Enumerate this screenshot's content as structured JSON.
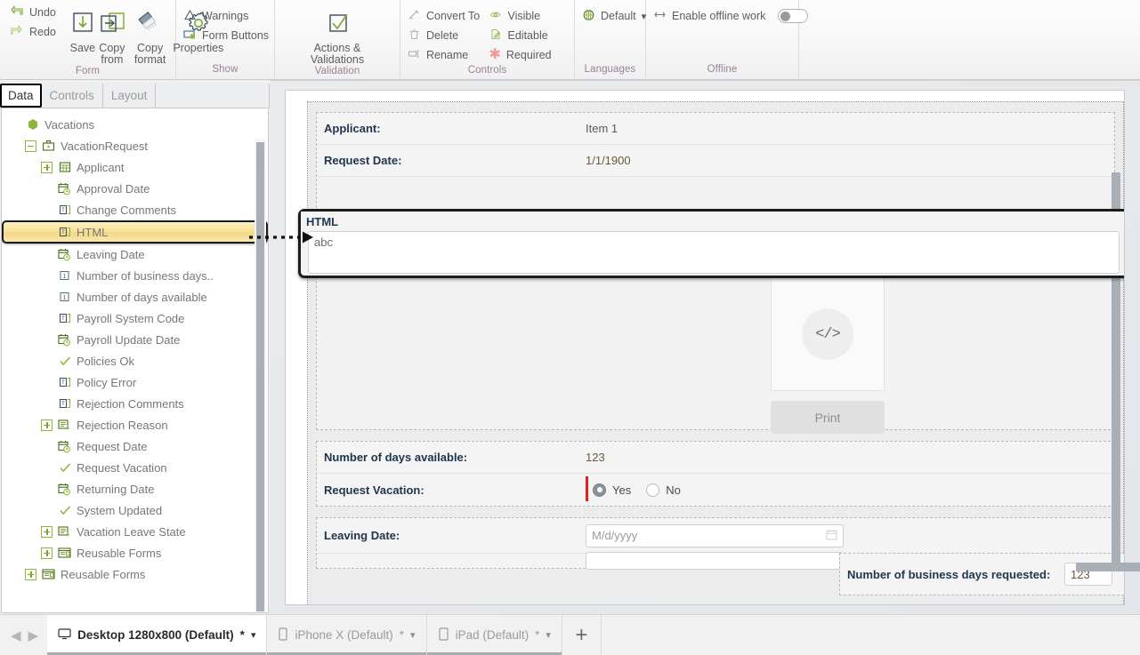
{
  "ribbon": {
    "groups": [
      {
        "title": "Form",
        "undo": "Undo",
        "redo": "Redo",
        "buttons": [
          {
            "label": "Save",
            "icon": "save-icon"
          },
          {
            "label": "Copy from",
            "icon": "copy-from-icon"
          },
          {
            "label": "Copy format",
            "icon": "copy-format-icon"
          },
          {
            "label": "Properties",
            "icon": "properties-gear-icon"
          }
        ]
      },
      {
        "title": "Show",
        "items": [
          {
            "label": "Warnings",
            "icon": "warning-triangle-icon"
          },
          {
            "label": "Form Buttons",
            "icon": "form-buttons-icon"
          }
        ]
      },
      {
        "title": "Validation",
        "buttons": [
          {
            "label": "Actions & Validations",
            "icon": "checkbox-check-icon"
          }
        ]
      },
      {
        "title": "Controls",
        "items": [
          {
            "label": "Convert To",
            "icon": "convert-to-icon"
          },
          {
            "label": "Delete",
            "icon": "trash-icon"
          },
          {
            "label": "Rename",
            "icon": "rename-icon"
          },
          {
            "label": "Visible",
            "icon": "eye-icon"
          },
          {
            "label": "Editable",
            "icon": "editable-page-icon"
          },
          {
            "label": "Required",
            "icon": "asterisk-icon"
          }
        ]
      },
      {
        "title": "Languages",
        "items": [
          {
            "label": "Default",
            "icon": "globe-icon",
            "dropdown": "▾"
          }
        ]
      },
      {
        "title": "Offline",
        "items": [
          {
            "label": "Enable offline work",
            "icon": "offline-sync-icon",
            "toggle": "off"
          }
        ]
      }
    ]
  },
  "sidebar": {
    "tabs": [
      {
        "label": "Data",
        "selected": true
      },
      {
        "label": "Controls",
        "selected": false
      },
      {
        "label": "Layout",
        "selected": false
      }
    ],
    "tree": [
      {
        "label": "Vacations",
        "indent": 0,
        "expander": "none",
        "icon": "package-icon",
        "selected": false
      },
      {
        "label": "VacationRequest",
        "indent": 1,
        "expander": "minus",
        "icon": "business-case-icon",
        "selected": false
      },
      {
        "label": "Applicant",
        "indent": 2,
        "expander": "plus",
        "icon": "table-icon",
        "selected": false
      },
      {
        "label": "Approval Date",
        "indent": 2,
        "expander": "none",
        "icon": "datetime-icon",
        "selected": false
      },
      {
        "label": "Change Comments",
        "indent": 2,
        "expander": "none",
        "icon": "text-field-icon",
        "selected": false
      },
      {
        "label": "HTML",
        "indent": 2,
        "expander": "none",
        "icon": "text-field-icon",
        "selected": true
      },
      {
        "label": "Leaving Date",
        "indent": 2,
        "expander": "none",
        "icon": "datetime-icon",
        "selected": false
      },
      {
        "label": "Number of business days..",
        "indent": 2,
        "expander": "none",
        "icon": "numeric-icon",
        "selected": false
      },
      {
        "label": "Number of days available",
        "indent": 2,
        "expander": "none",
        "icon": "numeric-icon",
        "selected": false
      },
      {
        "label": "Payroll System Code",
        "indent": 2,
        "expander": "none",
        "icon": "text-field-icon",
        "selected": false
      },
      {
        "label": "Payroll Update Date",
        "indent": 2,
        "expander": "none",
        "icon": "datetime-icon",
        "selected": false
      },
      {
        "label": "Policies Ok",
        "indent": 2,
        "expander": "none",
        "icon": "boolean-check-icon",
        "selected": false
      },
      {
        "label": "Policy Error",
        "indent": 2,
        "expander": "none",
        "icon": "text-field-icon",
        "selected": false
      },
      {
        "label": "Rejection Comments",
        "indent": 2,
        "expander": "none",
        "icon": "text-field-icon",
        "selected": false
      },
      {
        "label": "Rejection Reason",
        "indent": 2,
        "expander": "plus",
        "icon": "enum-icon",
        "selected": false
      },
      {
        "label": "Request Date",
        "indent": 2,
        "expander": "none",
        "icon": "datetime-icon",
        "selected": false
      },
      {
        "label": "Request Vacation",
        "indent": 2,
        "expander": "none",
        "icon": "boolean-check-icon",
        "selected": false
      },
      {
        "label": "Returning Date",
        "indent": 2,
        "expander": "none",
        "icon": "datetime-icon",
        "selected": false
      },
      {
        "label": "System Updated",
        "indent": 2,
        "expander": "none",
        "icon": "boolean-check-icon",
        "selected": false
      },
      {
        "label": "Vacation Leave State",
        "indent": 2,
        "expander": "plus",
        "icon": "enum-icon",
        "selected": false
      },
      {
        "label": "Reusable Forms",
        "indent": 2,
        "expander": "plus",
        "icon": "reusable-form-icon",
        "selected": false
      },
      {
        "label": "Reusable Forms",
        "indent": 1,
        "expander": "plus",
        "icon": "reusable-form-icon",
        "selected": false
      }
    ]
  },
  "form": {
    "rows": [
      {
        "label": "Applicant:",
        "value": "Item 1"
      },
      {
        "label": "Request Date:",
        "value": "1/1/1900"
      }
    ],
    "html_field": {
      "label": "HTML",
      "value": "abc"
    },
    "preview": {
      "icon_text": "</>",
      "print_label": "Print"
    },
    "days_row": {
      "label": "Number of days available:",
      "value": "123"
    },
    "request_vacation": {
      "label": "Request Vacation:",
      "yes_label": "Yes",
      "no_label": "No",
      "selected": "Yes"
    },
    "leaving_date": {
      "label": "Leaving Date:",
      "placeholder": "M/d/yyyy"
    },
    "business_days": {
      "label": "Number of business days requested:",
      "value": "123"
    }
  },
  "bottom": {
    "prev_icon": "◀",
    "next_icon": "▶",
    "tabs": [
      {
        "label": "Desktop 1280x800 (Default)",
        "modified": "*",
        "icon": "monitor-icon",
        "selected": true
      },
      {
        "label": "iPhone X (Default)",
        "modified": "*",
        "icon": "phone-icon",
        "selected": false
      },
      {
        "label": "iPad (Default)",
        "modified": "*",
        "icon": "tablet-icon",
        "selected": false
      }
    ],
    "add_label": "+"
  },
  "colors": {
    "accent_green": "#8cb63c",
    "ribbon_group_title": "#9b7f96",
    "selection_yellow": "#f3d884",
    "required_red": "#e02020",
    "label_navy": "#21374e"
  }
}
